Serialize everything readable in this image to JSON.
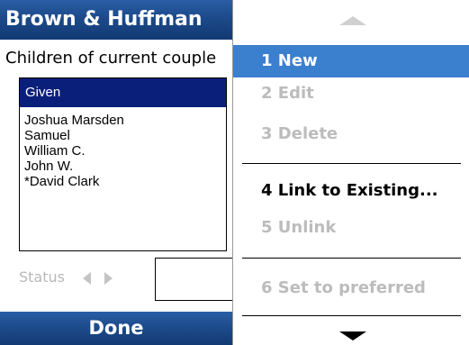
{
  "app": {
    "title": "Brown & Huffman",
    "section_label": "Children of current couple",
    "list": {
      "header": "Given",
      "items": [
        "Joshua Marsden",
        "Samuel",
        "William C.",
        "John W.",
        "*David Clark"
      ]
    },
    "status": {
      "label": "Status",
      "value": ""
    },
    "done_label": "Done"
  },
  "menu": {
    "items": [
      {
        "label": "1 New",
        "state": "selected"
      },
      {
        "label": "2 Edit",
        "state": "disabled"
      },
      {
        "label": "3 Delete",
        "state": "disabled"
      },
      {
        "label": "4 Link to Existing...",
        "state": "enabled"
      },
      {
        "label": "5 Unlink",
        "state": "disabled"
      },
      {
        "label": "6 Set to preferred",
        "state": "disabled"
      }
    ]
  },
  "colors": {
    "title_bar": "#1c4a8a",
    "list_header_bg": "#0a1f7a",
    "menu_selected_bg": "#3b7fcf",
    "disabled_text": "#bcbcbc"
  }
}
